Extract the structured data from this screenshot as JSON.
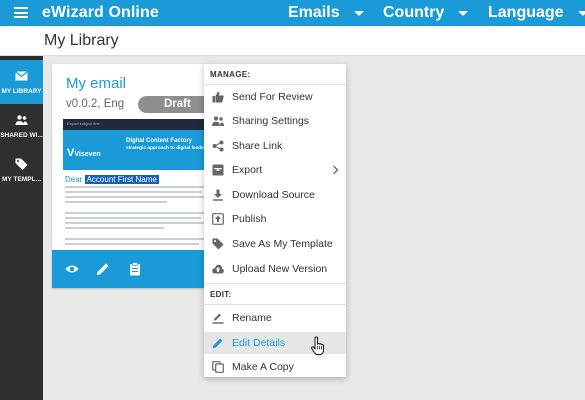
{
  "topbar": {
    "app_title": "eWizard Online",
    "nav": [
      {
        "label": "Emails"
      },
      {
        "label": "Country"
      },
      {
        "label": "Language"
      }
    ]
  },
  "page": {
    "title": "My Library"
  },
  "sidebar": {
    "items": [
      {
        "label": "MY LIBRARY",
        "icon": "envelope-icon",
        "active": true
      },
      {
        "label": "SHARED WI...",
        "icon": "people-icon",
        "active": false
      },
      {
        "label": "MY TEMPL...",
        "icon": "tag-icon",
        "active": false
      }
    ]
  },
  "card": {
    "name": "My email",
    "meta": "v0.0.2, Eng",
    "status": "Draft",
    "preview": {
      "topstrip_text": "Export subject line",
      "logo_text": "Viseven",
      "brand": "Digital Content Factory",
      "tagline": "strategic approach to digital leaders",
      "dear": "Dear",
      "placeholder": "Account First Name"
    },
    "footer_icons": [
      "eye-icon",
      "pencil-icon",
      "clipboard-icon"
    ]
  },
  "menu": {
    "manage_header": "MANAGE:",
    "edit_header": "EDIT:",
    "manage_items": [
      {
        "label": "Send For Review",
        "icon": "thumbs-up-icon"
      },
      {
        "label": "Sharing Settings",
        "icon": "people-icon"
      },
      {
        "label": "Share Link",
        "icon": "share-icon"
      },
      {
        "label": "Export",
        "icon": "archive-icon",
        "submenu": true
      },
      {
        "label": "Download Source",
        "icon": "download-icon"
      },
      {
        "label": "Publish",
        "icon": "upload-box-icon"
      },
      {
        "label": "Save As My Template",
        "icon": "tag-icon"
      },
      {
        "label": "Upload New Version",
        "icon": "cloud-upload-icon"
      }
    ],
    "edit_items": [
      {
        "label": "Rename",
        "icon": "rename-icon"
      },
      {
        "label": "Edit Details",
        "icon": "pencil-icon",
        "hovered": true
      },
      {
        "label": "Make A Copy",
        "icon": "copy-icon"
      }
    ]
  },
  "colors": {
    "accent": "#1a9bd7",
    "sidebar": "#2f2f2f",
    "status_badge": "#8e8e8e",
    "background": "#e9e9e9"
  }
}
